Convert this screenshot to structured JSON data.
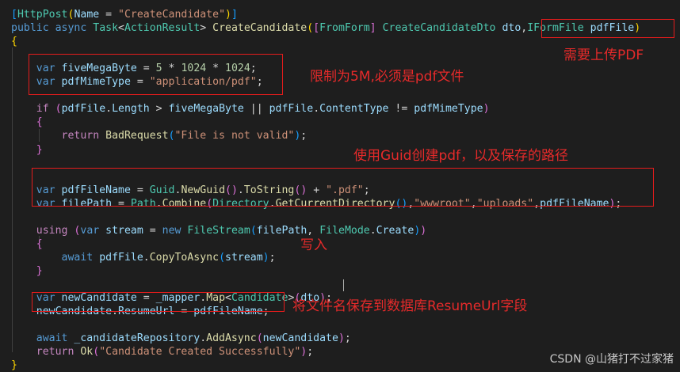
{
  "code": {
    "lines": [
      [
        [
          "b3",
          "["
        ],
        [
          "t",
          "HttpPost"
        ],
        [
          "b1",
          "("
        ],
        [
          "v",
          "Name"
        ],
        [
          "p",
          " = "
        ],
        [
          "s",
          "\"CreateCandidate\""
        ],
        [
          "b1",
          ")"
        ],
        [
          "b3",
          "]"
        ]
      ],
      [
        [
          "k",
          "public"
        ],
        [
          "p",
          " "
        ],
        [
          "k",
          "async"
        ],
        [
          "p",
          " "
        ],
        [
          "t",
          "Task"
        ],
        [
          "p",
          "<"
        ],
        [
          "t",
          "ActionResult"
        ],
        [
          "p",
          "> "
        ],
        [
          "m",
          "CreateCandidate"
        ],
        [
          "b1",
          "("
        ],
        [
          "b2",
          "["
        ],
        [
          "t",
          "FromForm"
        ],
        [
          "b2",
          "]"
        ],
        [
          "p",
          " "
        ],
        [
          "t",
          "CreateCandidateDto"
        ],
        [
          "p",
          " "
        ],
        [
          "v",
          "dto"
        ],
        [
          "p",
          ","
        ],
        [
          "t",
          "IFormFile"
        ],
        [
          "p",
          " "
        ],
        [
          "v",
          "pdfFile"
        ],
        [
          "b1",
          ")"
        ]
      ],
      [
        [
          "b1",
          "{"
        ]
      ],
      [],
      [
        [
          "p",
          "    "
        ],
        [
          "k",
          "var"
        ],
        [
          "p",
          " "
        ],
        [
          "v",
          "fiveMegaByte"
        ],
        [
          "p",
          " = "
        ],
        [
          "n",
          "5"
        ],
        [
          "p",
          " * "
        ],
        [
          "n",
          "1024"
        ],
        [
          "p",
          " * "
        ],
        [
          "n",
          "1024"
        ],
        [
          "p",
          ";"
        ]
      ],
      [
        [
          "p",
          "    "
        ],
        [
          "k",
          "var"
        ],
        [
          "p",
          " "
        ],
        [
          "v",
          "pdfMimeType"
        ],
        [
          "p",
          " = "
        ],
        [
          "s",
          "\"application/pdf\""
        ],
        [
          "p",
          ";"
        ]
      ],
      [],
      [
        [
          "p",
          "    "
        ],
        [
          "cf",
          "if"
        ],
        [
          "p",
          " "
        ],
        [
          "b2",
          "("
        ],
        [
          "v",
          "pdfFile"
        ],
        [
          "p",
          "."
        ],
        [
          "v",
          "Length"
        ],
        [
          "p",
          " > "
        ],
        [
          "v",
          "fiveMegaByte"
        ],
        [
          "p",
          " || "
        ],
        [
          "v",
          "pdfFile"
        ],
        [
          "p",
          "."
        ],
        [
          "v",
          "ContentType"
        ],
        [
          "p",
          " != "
        ],
        [
          "v",
          "pdfMimeType"
        ],
        [
          "b2",
          ")"
        ]
      ],
      [
        [
          "p",
          "    "
        ],
        [
          "b2",
          "{"
        ]
      ],
      [
        [
          "p",
          "        "
        ],
        [
          "cf",
          "return"
        ],
        [
          "p",
          " "
        ],
        [
          "m",
          "BadRequest"
        ],
        [
          "b3",
          "("
        ],
        [
          "s",
          "\"File is not valid\""
        ],
        [
          "b3",
          ")"
        ],
        [
          "p",
          ";"
        ]
      ],
      [
        [
          "p",
          "    "
        ],
        [
          "b2",
          "}"
        ]
      ],
      [],
      [],
      [
        [
          "p",
          "    "
        ],
        [
          "k",
          "var"
        ],
        [
          "p",
          " "
        ],
        [
          "v",
          "pdfFileName"
        ],
        [
          "p",
          " = "
        ],
        [
          "t",
          "Guid"
        ],
        [
          "p",
          "."
        ],
        [
          "m",
          "NewGuid"
        ],
        [
          "b2",
          "()"
        ],
        [
          "p",
          "."
        ],
        [
          "m",
          "ToString"
        ],
        [
          "b2",
          "()"
        ],
        [
          "p",
          " + "
        ],
        [
          "s",
          "\".pdf\""
        ],
        [
          "p",
          ";"
        ]
      ],
      [
        [
          "p",
          "    "
        ],
        [
          "k",
          "var"
        ],
        [
          "p",
          " "
        ],
        [
          "v",
          "filePath"
        ],
        [
          "p",
          " = "
        ],
        [
          "t",
          "Path"
        ],
        [
          "p",
          "."
        ],
        [
          "m",
          "Combine"
        ],
        [
          "b2",
          "("
        ],
        [
          "t",
          "Directory"
        ],
        [
          "p",
          "."
        ],
        [
          "m",
          "GetCurrentDirectory"
        ],
        [
          "b3",
          "()"
        ],
        [
          "p",
          ","
        ],
        [
          "s",
          "\"wwwroot\""
        ],
        [
          "p",
          ","
        ],
        [
          "s",
          "\"uploads\""
        ],
        [
          "p",
          ","
        ],
        [
          "v",
          "pdfFileName"
        ],
        [
          "b2",
          ")"
        ],
        [
          "p",
          ";"
        ]
      ],
      [],
      [
        [
          "p",
          "    "
        ],
        [
          "cf",
          "using"
        ],
        [
          "p",
          " "
        ],
        [
          "b2",
          "("
        ],
        [
          "k",
          "var"
        ],
        [
          "p",
          " "
        ],
        [
          "v",
          "stream"
        ],
        [
          "p",
          " = "
        ],
        [
          "k",
          "new"
        ],
        [
          "p",
          " "
        ],
        [
          "t",
          "FileStream"
        ],
        [
          "b3",
          "("
        ],
        [
          "v",
          "filePath"
        ],
        [
          "p",
          ", "
        ],
        [
          "t",
          "FileMode"
        ],
        [
          "p",
          "."
        ],
        [
          "v",
          "Create"
        ],
        [
          "b3",
          ")"
        ],
        [
          "b2",
          ")"
        ]
      ],
      [
        [
          "p",
          "    "
        ],
        [
          "b2",
          "{"
        ]
      ],
      [
        [
          "p",
          "        "
        ],
        [
          "k",
          "await"
        ],
        [
          "p",
          " "
        ],
        [
          "v",
          "pdfFile"
        ],
        [
          "p",
          "."
        ],
        [
          "m",
          "CopyToAsync"
        ],
        [
          "b3",
          "("
        ],
        [
          "v",
          "stream"
        ],
        [
          "b3",
          ")"
        ],
        [
          "p",
          ";"
        ]
      ],
      [
        [
          "p",
          "    "
        ],
        [
          "b2",
          "}"
        ]
      ],
      [],
      [
        [
          "p",
          "    "
        ],
        [
          "k",
          "var"
        ],
        [
          "p",
          " "
        ],
        [
          "v",
          "newCandidate"
        ],
        [
          "p",
          " = "
        ],
        [
          "v",
          "_mapper"
        ],
        [
          "p",
          "."
        ],
        [
          "m",
          "Map"
        ],
        [
          "p",
          "<"
        ],
        [
          "t",
          "Candidate"
        ],
        [
          "p",
          ">"
        ],
        [
          "b2",
          "("
        ],
        [
          "v",
          "dto"
        ],
        [
          "b2",
          ")"
        ],
        [
          "p",
          ";"
        ]
      ],
      [
        [
          "p",
          "    "
        ],
        [
          "v",
          "newCandidate"
        ],
        [
          "p",
          "."
        ],
        [
          "v",
          "ResumeUrl"
        ],
        [
          "p",
          " = "
        ],
        [
          "v",
          "pdfFileName"
        ],
        [
          "p",
          ";"
        ]
      ],
      [],
      [
        [
          "p",
          "    "
        ],
        [
          "k",
          "await"
        ],
        [
          "p",
          " "
        ],
        [
          "v",
          "_candidateRepository"
        ],
        [
          "p",
          "."
        ],
        [
          "m",
          "AddAsync"
        ],
        [
          "b2",
          "("
        ],
        [
          "v",
          "newCandidate"
        ],
        [
          "b2",
          ")"
        ],
        [
          "p",
          ";"
        ]
      ],
      [
        [
          "p",
          "    "
        ],
        [
          "cf",
          "return"
        ],
        [
          "p",
          " "
        ],
        [
          "m",
          "Ok"
        ],
        [
          "b2",
          "("
        ],
        [
          "s",
          "\"Candidate Created Successfully\""
        ],
        [
          "b2",
          ")"
        ],
        [
          "p",
          ";"
        ]
      ],
      [
        [
          "b1",
          "}"
        ]
      ]
    ]
  },
  "annotations": {
    "upload_pdf": "需要上传PDF",
    "limit_5m": "限制为5M,必须是pdf文件",
    "guid_path": "使用Guid创建pdf，以及保存的路径",
    "write": "写入",
    "save_db": "将文件名保存到数据库ResumeUrl字段"
  },
  "watermark": "CSDN @山猪打不过家猪",
  "colors": {
    "background": "#1e1e1e",
    "annotation_red": "#e51c1c",
    "keyword": "#569cd6",
    "string": "#ce9178",
    "type": "#4ec9b0",
    "variable": "#9cdcfe",
    "method": "#dcdcaa"
  }
}
